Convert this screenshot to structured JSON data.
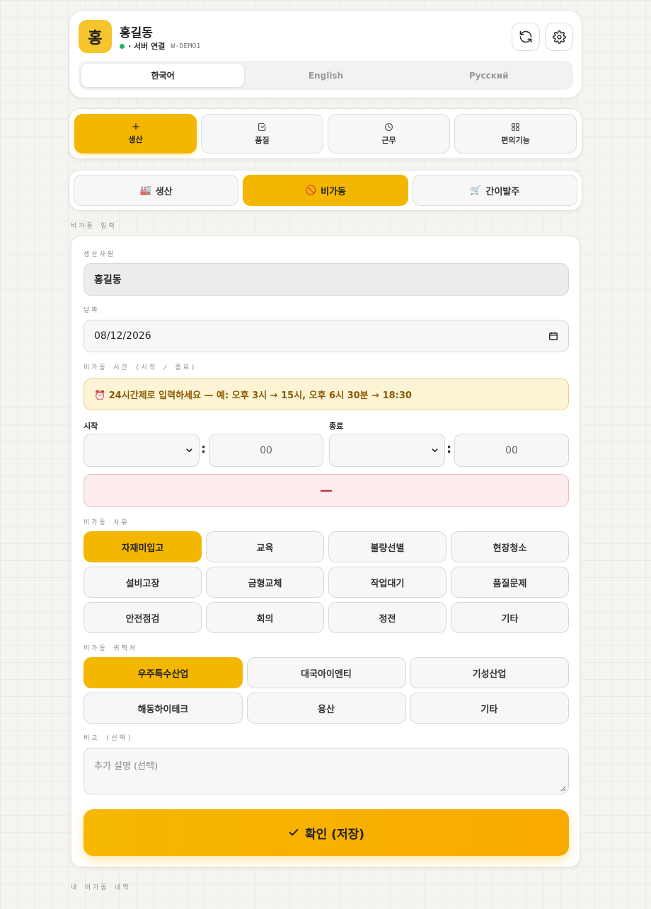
{
  "header": {
    "avatar_initial": "홍",
    "user_name": "홍길동",
    "status_text": "· 서버 연결",
    "worker_id": "W-DEMO1",
    "refresh_icon": "refresh-icon",
    "settings_icon": "gear-icon",
    "languages": [
      "한국어",
      "English",
      "Русский"
    ],
    "active_language": "한국어"
  },
  "main_nav": [
    {
      "label": "생산",
      "icon": "plus-icon",
      "active": true
    },
    {
      "label": "품질",
      "icon": "checkbox-icon",
      "active": false
    },
    {
      "label": "근무",
      "icon": "clock-icon",
      "active": false
    },
    {
      "label": "편의기능",
      "icon": "grid-icon",
      "active": false
    }
  ],
  "sub_nav": [
    {
      "label": "생산",
      "icon": "🏭",
      "active": false
    },
    {
      "label": "비가동",
      "icon": "🚫",
      "active": true
    },
    {
      "label": "간이발주",
      "icon": "🛒",
      "active": false
    }
  ],
  "section_title": "비가동 입력",
  "form": {
    "worker_label": "생산사원",
    "worker_value": "홍길동",
    "date_label": "날짜",
    "date_value": "08/12/2026",
    "time_label": "비가동 시간 (시작 / 종료)",
    "time_notice": "⏰ 24시간제로 입력하세요 — 예: 오후 3시 → 15시, 오후 6시 30분 → 18:30",
    "start_label": "시작",
    "end_label": "종료",
    "start_hour": "",
    "start_minute_placeholder": "00",
    "end_hour": "",
    "end_minute_placeholder": "00",
    "duration_text": "—",
    "reason_label": "비가동 사유",
    "reasons": [
      "자재미입고",
      "교육",
      "불량선별",
      "현장청소",
      "설비고장",
      "금형교체",
      "작업대기",
      "품질문제",
      "안전점검",
      "회의",
      "정전",
      "기타"
    ],
    "selected_reason": "자재미입고",
    "responsible_label": "비가동 귀책처",
    "responsibles": [
      "우주특수산업",
      "대국아이엔티",
      "기성산업",
      "해동하이테크",
      "용산",
      "기타"
    ],
    "selected_responsible": "우주특수산업",
    "note_label": "비고 (선택)",
    "note_placeholder": "추가 설명 (선택)",
    "submit_label": "확인 (저장)"
  },
  "history_title": "내 비가동 내역",
  "colors": {
    "accent": "#f3b700",
    "status_green": "#22b35e",
    "notice_bg": "#fdf4d6",
    "duration_bg": "#fdecee"
  }
}
